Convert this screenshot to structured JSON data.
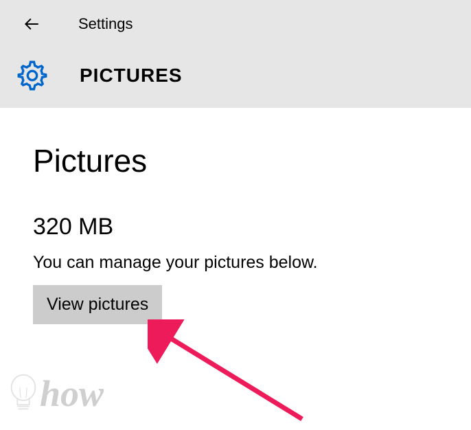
{
  "header": {
    "title": "Settings",
    "breadcrumb": "PICTURES"
  },
  "content": {
    "heading": "Pictures",
    "size": "320 MB",
    "description": "You can manage your pictures below.",
    "button_label": "View pictures"
  },
  "watermark": {
    "text": "how"
  },
  "colors": {
    "header_bg": "#e6e6e6",
    "gear_icon": "#0066cc",
    "button_bg": "#cccccc",
    "arrow": "#ed1b5a"
  }
}
